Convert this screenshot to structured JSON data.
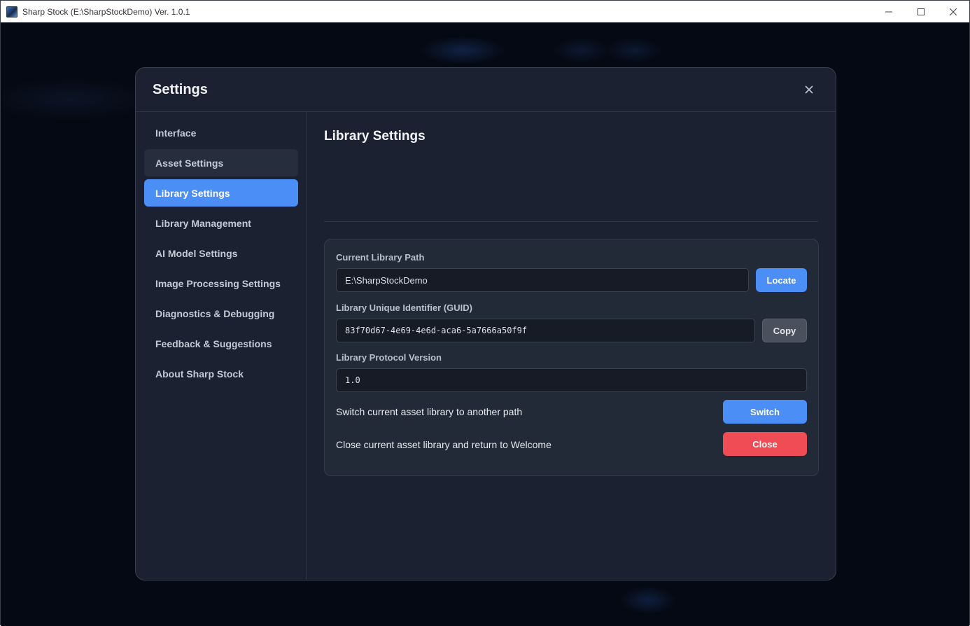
{
  "window": {
    "title": "Sharp Stock (E:\\SharpStockDemo) Ver. 1.0.1"
  },
  "modal": {
    "title": "Settings"
  },
  "sidebar": {
    "items": [
      {
        "label": "Interface"
      },
      {
        "label": "Asset Settings"
      },
      {
        "label": "Library Settings"
      },
      {
        "label": "Library Management"
      },
      {
        "label": "AI Model Settings"
      },
      {
        "label": "Image Processing Settings"
      },
      {
        "label": "Diagnostics & Debugging"
      },
      {
        "label": "Feedback & Suggestions"
      },
      {
        "label": "About Sharp Stock"
      }
    ],
    "active": "Library Settings"
  },
  "library": {
    "title": "Library Settings",
    "path_label": "Current Library Path",
    "path_value": "E:\\SharpStockDemo",
    "locate_label": "Locate",
    "guid_label": "Library Unique Identifier (GUID)",
    "guid_value": "83f70d67-4e69-4e6d-aca6-5a7666a50f9f",
    "copy_label": "Copy",
    "protocol_label": "Library Protocol Version",
    "protocol_value": "1.0",
    "switch_text": "Switch current asset library to another path",
    "switch_label": "Switch",
    "close_text": "Close current asset library and return to Welcome",
    "close_label": "Close"
  },
  "colors": {
    "accent": "#4b8ef5",
    "danger": "#f04c55",
    "panel": "#1b2130"
  }
}
